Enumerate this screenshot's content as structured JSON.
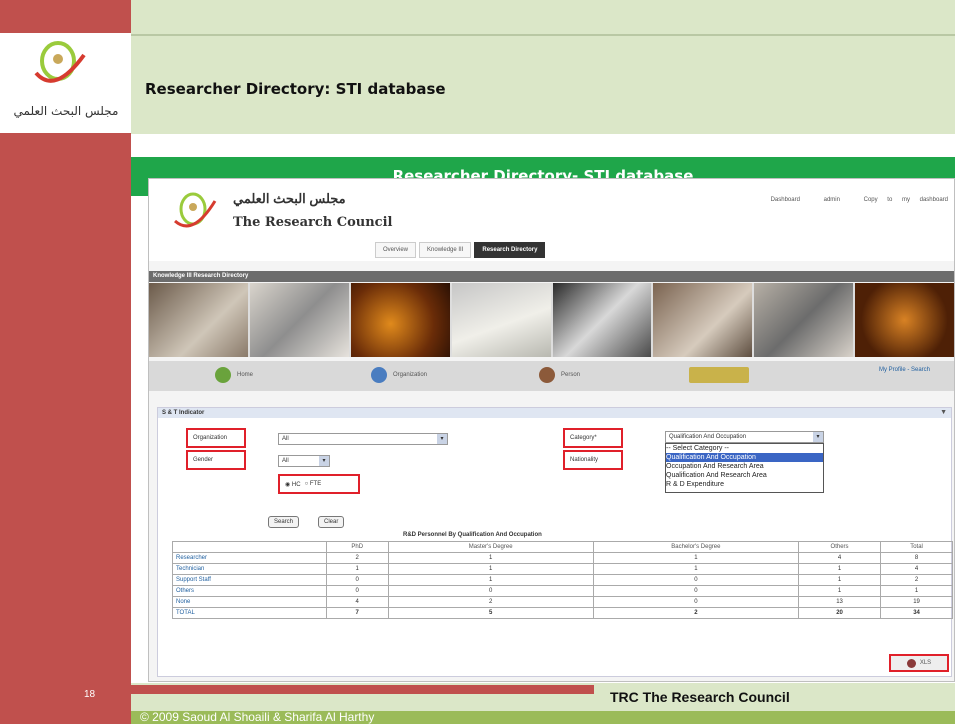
{
  "slide": {
    "title": "Researcher Directory: STI database",
    "banner_title": "Researcher Directory- STI database",
    "number": "18",
    "footer_org": "TRC The Research Council",
    "copyright": "© 2009 Saoud Al Shoaili & Sharifa Al Harthy",
    "colors": {
      "left_bar": "#c0504d",
      "title_band": "#dbe7c8",
      "banner": "#1fa64a",
      "highlight": "#e0202a"
    }
  },
  "app": {
    "logo_arabic": "مجلس البحث العلمي",
    "logo_english": "The Research Council",
    "top_links": [
      "Dashboard",
      "admin",
      "Copy to my dashboard"
    ],
    "nav_tabs": [
      "Overview",
      "Knowledge III",
      "Research Directory"
    ],
    "active_tab": "Research Directory",
    "directory_bar": "Knowledge III Research Directory",
    "menu": [
      "Home",
      "Organization",
      "Person"
    ],
    "menu_right": "My Profile - Search",
    "panel_title": "S & T Indicator",
    "filters": {
      "organization_label": "Organization",
      "organization_value": "All",
      "gender_label": "Gender",
      "gender_value": "All",
      "radio_options": [
        "HC",
        "FTE"
      ],
      "category_label": "Category*",
      "category_value": "Qualification And Occupation",
      "nationality_label": "Nationality",
      "category_options": [
        "-- Select Category --",
        "Qualification And Occupation",
        "Occupation And Research Area",
        "Qualification And Research Area",
        "R & D Expenditure"
      ],
      "category_selected_index": 1
    },
    "buttons": {
      "search": "Search",
      "clear": "Clear"
    },
    "table": {
      "title": "R&D Personnel By Qualification And Occupation",
      "headers": [
        "",
        "PhD",
        "Master's Degree",
        "Bachelor's Degree",
        "Others",
        "Total"
      ],
      "rows": [
        [
          "Researcher",
          "2",
          "1",
          "1",
          "4",
          "8"
        ],
        [
          "Technician",
          "1",
          "1",
          "1",
          "1",
          "4"
        ],
        [
          "Support Staff",
          "0",
          "1",
          "0",
          "1",
          "2"
        ],
        [
          "Others",
          "0",
          "0",
          "0",
          "1",
          "1"
        ],
        [
          "None",
          "4",
          "2",
          "0",
          "13",
          "19"
        ],
        [
          "TOTAL",
          "7",
          "5",
          "2",
          "20",
          "34"
        ]
      ]
    },
    "export_label": "XLS"
  }
}
